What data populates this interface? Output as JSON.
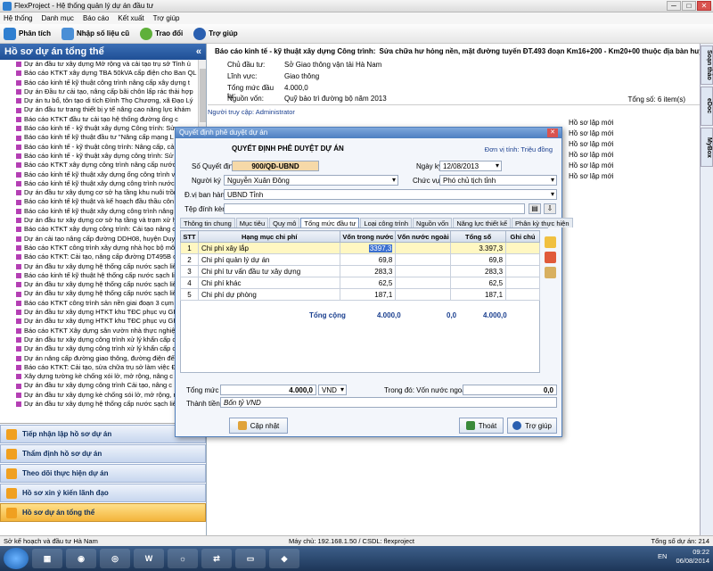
{
  "window": {
    "title": "FlexProject - Hệ thống quản lý dự án đầu tư",
    "buttons": [
      "─",
      "□",
      "✕"
    ]
  },
  "menu": [
    "Hệ thống",
    "Danh mục",
    "Báo cáo",
    "Kết xuất",
    "Trợ giúp"
  ],
  "toolbar": [
    {
      "label": "Phân tích",
      "color": "#2f7fd0"
    },
    {
      "label": "Nhập số liệu cũ",
      "color": "#4a8fd6"
    },
    {
      "label": "Trao đổi",
      "color": "#5fb03a"
    },
    {
      "label": "Trợ giúp",
      "color": "#2a5fb0"
    }
  ],
  "left": {
    "header": "Hồ sơ dự án tổng thể",
    "tree": [
      "Dự án đầu tư xây dựng Mở rộng và cải tạo trụ sở Tỉnh ủ",
      "Báo cáo KTKT xây dựng TBA 50kVA cấp điện cho Ban QL",
      "Báo cáo kinh tế kỹ thuật công trình nâng cấp xây dựng t",
      "Dự án Đầu tư cải tạo, nâng cấp bãi chôn lấp rác thải hợp",
      "Dự án tu bổ, tôn tạo di tích Đình Thọ Chương, xã Đạo Lý",
      "Dự án đầu tư trang thiết bị y tế nâng cao năng lực khám",
      "Báo cáo KTKT đầu tư cải tạo hệ thống đường ống c",
      "Báo cáo kinh tế - kỹ thuật xây dựng Công trình: Sử",
      "Báo cáo kinh tế kỹ thuật đầu tư \"Nâng cấp mạng L",
      "Báo cáo kinh tế - kỹ thuật công trình: Nâng cấp, cả",
      "Báo cáo kinh tế - kỹ thuật xây dựng công trình: Sử",
      "Báo cáo KTKT xây dựng công trình nâng cấp nước phụ",
      "Báo cáo kinh tế kỹ thuật xây dựng ống công trình về s",
      "Báo cáo kinh tế kỹ thuật xây dựng công trình nước sạch và n",
      "Dự án đầu tư xây dựng cơ sở hạ tầng khu nuôi trồng thủy",
      "Báo cáo kinh tế kỹ thuật và kế hoạch đầu thầu côn",
      "Báo cáo kinh tế kỹ thuật xây dựng công trình nâng cấp xây d",
      "Dự án đầu tư xây dựng cơ sở hạ tầng và trạm xử lý",
      "Báo cáo KTKT xây dựng công trình: Cải tạo nâng cấp",
      "Dự án cải tạo nâng cấp đường DDH08, huyện Duy T",
      "Báo cáo KTKT công trình xây dựng nhà học bộ mô",
      "Báo cáo KTKT: Cải tạo, nâng cấp đường DT495B của",
      "Dự án đầu tư xây dựng hệ thống cấp nước sạch liên",
      "Báo cáo kinh tế kỹ thuật hệ thống cấp nước sạch liên",
      "Dự án đầu tư xây dựng hệ thống cấp nước sạch liên xã Tâ",
      "Dự án đầu tư xây dựng hệ thống cấp nước sạch liên",
      "Báo cáo KTKT công trình sản nền giai đoạn 3 cụm",
      "Dự án đầu tư xây dựng HTKT khu TĐC phục vụ GPI",
      "Dự án đầu tư xây dựng HTKT khu TĐC phục vụ GPI",
      "Báo cáo KTKT Xây dựng sân vườn nhà thực nghiệm",
      "Dự án đầu tư xây dựng công trình xử lý khẩn cấp c",
      "Dự án đầu tư xây dựng công trình xử lý khẩn cấp c",
      "Dự án nâng cấp đường giao thông, đường điện đế",
      "Báo cáo KTKT: Cải tạo, sửa chữa trụ sở làm việc Đ",
      "Xây dựng tường kè chống xói lở, mở rộng, nâng c",
      "Dự án đầu tư xây dựng công trình Cải tạo, nâng c",
      "Dự án đầu tư xây dựng kè chống sói lở, mở rộng, nâ",
      "Dự án đầu tư xây dựng hệ thống cấp nước sạch liên"
    ],
    "nav": [
      "Tiếp nhận lập hồ sơ dự án",
      "Thẩm định hồ sơ dự án",
      "Theo dõi thực hiện dự án",
      "Hồ sơ xin ý kiến lãnh đạo",
      "Hồ sơ dự án tổng thể"
    ]
  },
  "right": {
    "title_prefix": "Báo cáo kinh tế - kỹ thuật xây dựng Công trình:",
    "title_rest": "Sửa chữa hư hỏng nền, mặt đường tuyến ĐT.493 đoạn Km16+200 - Km20+00 thuộc địa bàn huyện Duy Tiên và t",
    "info": [
      {
        "k": "Chủ đầu tư:",
        "v": "Sở Giao thông vận tải Hà Nam"
      },
      {
        "k": "Lĩnh vực:",
        "v": "Giao thông"
      },
      {
        "k": "Tổng mức đầu tư:",
        "v": "4.000,0"
      },
      {
        "k": "Nguồn vốn:",
        "v": "Quỹ bảo trì đường bộ năm 2013"
      }
    ],
    "total_items": "Tổng số: 6 item(s)",
    "accessor": "Người truy cập: Administrator",
    "status_list": [
      "Hồ sơ lập mới",
      "Hồ sơ lập mới",
      "Hồ sơ lập mới",
      "Hồ sơ lập mới",
      "Hồ sơ lập mới",
      "Hồ sơ lập mới"
    ],
    "side_tabs": [
      "Soạn thảo",
      "eDoc",
      "MyBox"
    ]
  },
  "dialog": {
    "title": "Quyết định phê duyệt dự án",
    "heading": "QUYẾT ĐỊNH PHÊ DUYỆT DỰ ÁN",
    "unit": "Đơn vị tính: Triệu đồng",
    "labels": {
      "so_qd": "Số Quyết định",
      "ngay_ky": "Ngày ký",
      "nguoi_ky": "Người ký",
      "chuc_vu": "Chức vụ",
      "dv_ban_hanh": "Đ.vị ban hành",
      "tep": "Tệp đính kèm"
    },
    "values": {
      "so_qd": "900/QĐ-UBND",
      "ngay_ky": "12/08/2013",
      "nguoi_ky": "Nguyễn Xuân Đông",
      "chuc_vu": "Phó chủ tịch tỉnh",
      "dv_ban_hanh": "UBND Tỉnh",
      "tep": ""
    },
    "tabs": [
      "Thông tin chung",
      "Mục tiêu",
      "Quy mô",
      "Tổng mức đầu tư",
      "Loại công trình",
      "Nguồn vốn",
      "Năng lực thiết kế",
      "Phân kỳ thực hiện"
    ],
    "table": {
      "headers": [
        "STT",
        "Hạng mục chi phí",
        "Vốn trong nước",
        "Vốn nước ngoài",
        "Tổng số",
        "Ghi chú"
      ],
      "rows": [
        {
          "stt": "1",
          "name": "Chi phí xây lắp",
          "vtn": "3397,3",
          "vnn": "",
          "tong": "3.397,3",
          "note": ""
        },
        {
          "stt": "2",
          "name": "Chi phí quản lý dự án",
          "vtn": "69,8",
          "vnn": "",
          "tong": "69,8",
          "note": ""
        },
        {
          "stt": "3",
          "name": "Chi phí tư vấn đầu tư xây dựng",
          "vtn": "283,3",
          "vnn": "",
          "tong": "283,3",
          "note": ""
        },
        {
          "stt": "4",
          "name": "Chi phí khác",
          "vtn": "62,5",
          "vnn": "",
          "tong": "62,5",
          "note": ""
        },
        {
          "stt": "5",
          "name": "Chi phí dự phòng",
          "vtn": "187,1",
          "vnn": "",
          "tong": "187,1",
          "note": ""
        }
      ],
      "total": {
        "label": "Tổng cộng",
        "vtn": "4.000,0",
        "vnn": "0,0",
        "tong": "4.000,0"
      }
    },
    "tong_muc": {
      "label": "Tổng mức",
      "value": "4.000,0",
      "unit": "VND",
      "foreign_label": "Trong đó: Vốn nước ngoài",
      "foreign_value": "0,0"
    },
    "thanh_tien": {
      "label": "Thành tiền",
      "value": "Bốn tỷ VND"
    },
    "buttons": {
      "update": "Cập nhật",
      "exit": "Thoát",
      "help": "Trợ giúp"
    }
  },
  "status": {
    "left": "Sở kế hoạch và đầu tư Hà Nam",
    "middle": "Máy chủ: 192.168.1.50 / CSDL: flexproject",
    "right": "Tổng số dự án: 214"
  },
  "taskbar": {
    "lang": "EN",
    "time": "09:22",
    "date": "06/08/2014"
  }
}
